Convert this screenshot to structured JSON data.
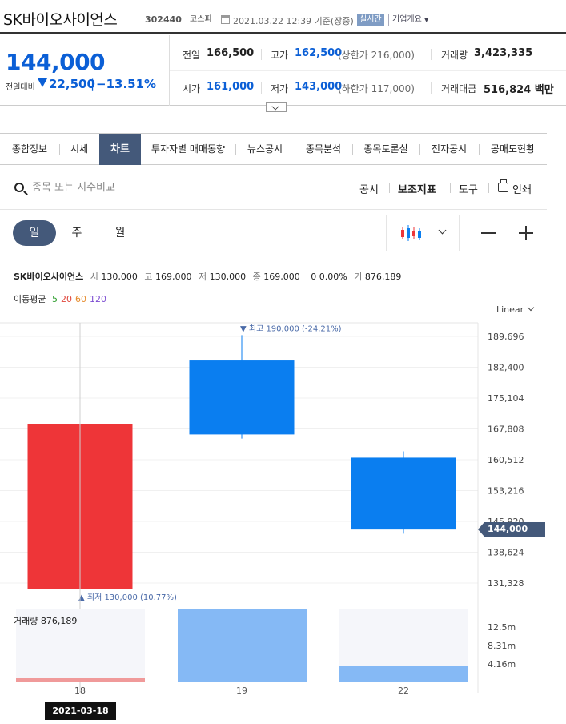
{
  "header": {
    "stock_name": "SK바이오사이언스",
    "stock_code": "302440",
    "market": "코스피",
    "date": "2021.03.22 12:39 기준(장중)",
    "realtime": "실시간",
    "company_info": "기업개요"
  },
  "price": {
    "current": "144,000",
    "change_label": "전일대비",
    "change": "22,500",
    "change_sep": "|",
    "change_pct": "−13.51%",
    "rows": {
      "prev_close_label": "전일",
      "prev_close": "166,500",
      "high_label": "고가",
      "high": "162,500",
      "upper_limit": "(상한가 216,000)",
      "volume_label": "거래량",
      "volume": "3,423,335",
      "open_label": "시가",
      "open": "161,000",
      "low_label": "저가",
      "low": "143,000",
      "lower_limit": "(하한가 117,000)",
      "amount_label": "거래대금",
      "amount": "516,824 백만"
    }
  },
  "tabs": [
    "종합정보",
    "시세",
    "차트",
    "투자자별 매매동향",
    "뉴스공시",
    "종목분석",
    "종목토론실",
    "전자공시",
    "공매도현황"
  ],
  "active_tab": "차트",
  "toolbar": {
    "search_placeholder": "종목 또는 지수비교",
    "disclosure": "공시",
    "indicator": "보조지표",
    "tools": "도구",
    "print": "인쇄"
  },
  "periods": [
    "일",
    "주",
    "월"
  ],
  "active_period": "일",
  "info": {
    "name": "SK바이오사이언스",
    "open_label": "시",
    "open": "130,000",
    "high_label": "고",
    "high": "169,000",
    "low_label": "저",
    "low": "130,000",
    "close_label": "종",
    "close": "169,000",
    "change": "0",
    "change_pct": "0.00%",
    "volume_label": "거",
    "volume": "876,189"
  },
  "moving_avg": {
    "label": "이동평균",
    "periods": [
      {
        "value": "5",
        "color": "#2e9e2e"
      },
      {
        "value": "20",
        "color": "#e0453a"
      },
      {
        "value": "60",
        "color": "#e58a2a"
      },
      {
        "value": "120",
        "color": "#7b4bd1"
      }
    ]
  },
  "scale_mode": "Linear",
  "volume_label": "거래량 876,189",
  "selected_date": "2021-03-18",
  "current_price_tag": "144,000",
  "colors": {
    "up": "#ee3538",
    "down": "#0a7ef0",
    "volume_up": "#f09a9a",
    "volume_down": "#85b9f5",
    "accent": "#44597a",
    "price_blue": "#0b5fd6"
  },
  "chart_data": {
    "type": "candlestick",
    "y_ticks": [
      "189,696",
      "182,400",
      "175,104",
      "167,808",
      "160,512",
      "153,216",
      "145,920",
      "138,624",
      "131,328"
    ],
    "y_tick_values": [
      189696,
      182400,
      175104,
      167808,
      160512,
      153216,
      145920,
      138624,
      131328
    ],
    "x_ticks": [
      "18",
      "19",
      "22"
    ],
    "candles": [
      {
        "date": "18",
        "open": 130000,
        "high": 169000,
        "low": 130000,
        "close": 169000,
        "volume": 876189
      },
      {
        "date": "19",
        "open": 184000,
        "high": 190000,
        "low": 165500,
        "close": 166500,
        "volume": 15000000
      },
      {
        "date": "22",
        "open": 161000,
        "high": 162500,
        "low": 143000,
        "close": 144000,
        "volume": 3423335
      }
    ],
    "max_annotation": "최고 190,000 (-24.21%)",
    "min_annotation": "최저 130,000 (10.77%)",
    "volume_ticks": [
      "12.5m",
      "8.31m",
      "4.16m"
    ],
    "volume_tick_values": [
      12500000,
      8310000,
      4160000
    ],
    "current_price": 144000
  }
}
